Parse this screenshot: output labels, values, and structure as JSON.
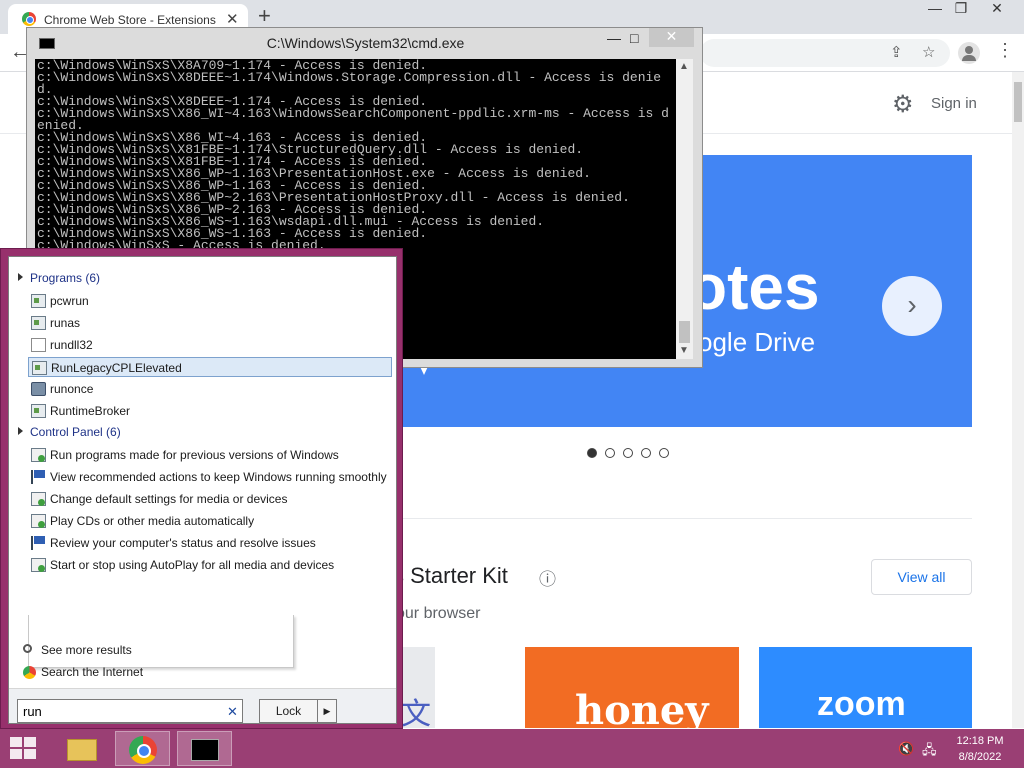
{
  "browser": {
    "tab_title": "Chrome Web Store - Extensions",
    "tab_close": "✕",
    "new_tab": "+",
    "window_controls": {
      "minimize": "—",
      "maximize": "❐",
      "close": "✕"
    },
    "back": "←",
    "menu": "⋮"
  },
  "store": {
    "sign_in": "Sign in",
    "banner_title": "otes",
    "banner_subtitle": "ogle Drive",
    "banner_next": "›",
    "carousel_count": 5,
    "carousel_active": 1,
    "section_title": "s Starter Kit",
    "section_subtitle": "our browser",
    "view_all": "View all",
    "tiles": [
      "文",
      "honey",
      "zoom"
    ],
    "icons": {
      "settings": "⚙",
      "info": "ⓘ",
      "share": "⇪",
      "star": "☆"
    }
  },
  "cmd": {
    "title": "C:\\Windows\\System32\\cmd.exe",
    "controls": {
      "minimize": "—",
      "maximize": "□",
      "close": "✕"
    },
    "lines": [
      "c:\\Windows\\WinSxS\\X8A709~1.174 - Access is denied.",
      "c:\\Windows\\WinSxS\\X8DEEE~1.174\\Windows.Storage.Compression.dll - Access is denied.",
      "c:\\Windows\\WinSxS\\X8DEEE~1.174 - Access is denied.",
      "c:\\Windows\\WinSxS\\X86_WI~4.163\\WindowsSearchComponent-ppdlic.xrm-ms - Access is denied.",
      "c:\\Windows\\WinSxS\\X86_WI~4.163 - Access is denied.",
      "c:\\Windows\\WinSxS\\X81FBE~1.174\\StructuredQuery.dll - Access is denied.",
      "c:\\Windows\\WinSxS\\X81FBE~1.174 - Access is denied.",
      "c:\\Windows\\WinSxS\\X86_WP~1.163\\PresentationHost.exe - Access is denied.",
      "c:\\Windows\\WinSxS\\X86_WP~1.163 - Access is denied.",
      "c:\\Windows\\WinSxS\\X86_WP~2.163\\PresentationHostProxy.dll - Access is denied.",
      "c:\\Windows\\WinSxS\\X86_WP~2.163 - Access is denied.",
      "c:\\Windows\\WinSxS\\X86_WS~1.163\\wsdapi.dll.mui - Access is denied.",
      "c:\\Windows\\WinSxS\\X86_WS~1.163 - Access is denied.",
      "c:\\Windows\\WinSxS - Access is denied."
    ]
  },
  "start_menu": {
    "programs_header": "Programs (6)",
    "programs": [
      "pcwrun",
      "runas",
      "rundll32",
      "RunLegacyCPLElevated",
      "runonce",
      "RuntimeBroker"
    ],
    "selected_program": "RunLegacyCPLElevated",
    "control_panel_header": "Control Panel (6)",
    "control_panel": [
      "Run programs made for previous versions of Windows",
      "View recommended actions to keep Windows running smoothly",
      "Change default settings for media or devices",
      "Play CDs or other media automatically",
      "Review your computer's status and resolve issues",
      "Start or stop using AutoPlay for all media and devices"
    ],
    "see_more": "See more results",
    "search_internet": "Search the Internet",
    "search_value": "run",
    "search_clear": "✕",
    "lock_label": "Lock",
    "lock_arrow": "▶"
  },
  "taskbar": {
    "time": "12:18 PM",
    "date": "8/8/2022",
    "tray": {
      "volume": "🔇",
      "network": "🖧"
    }
  }
}
